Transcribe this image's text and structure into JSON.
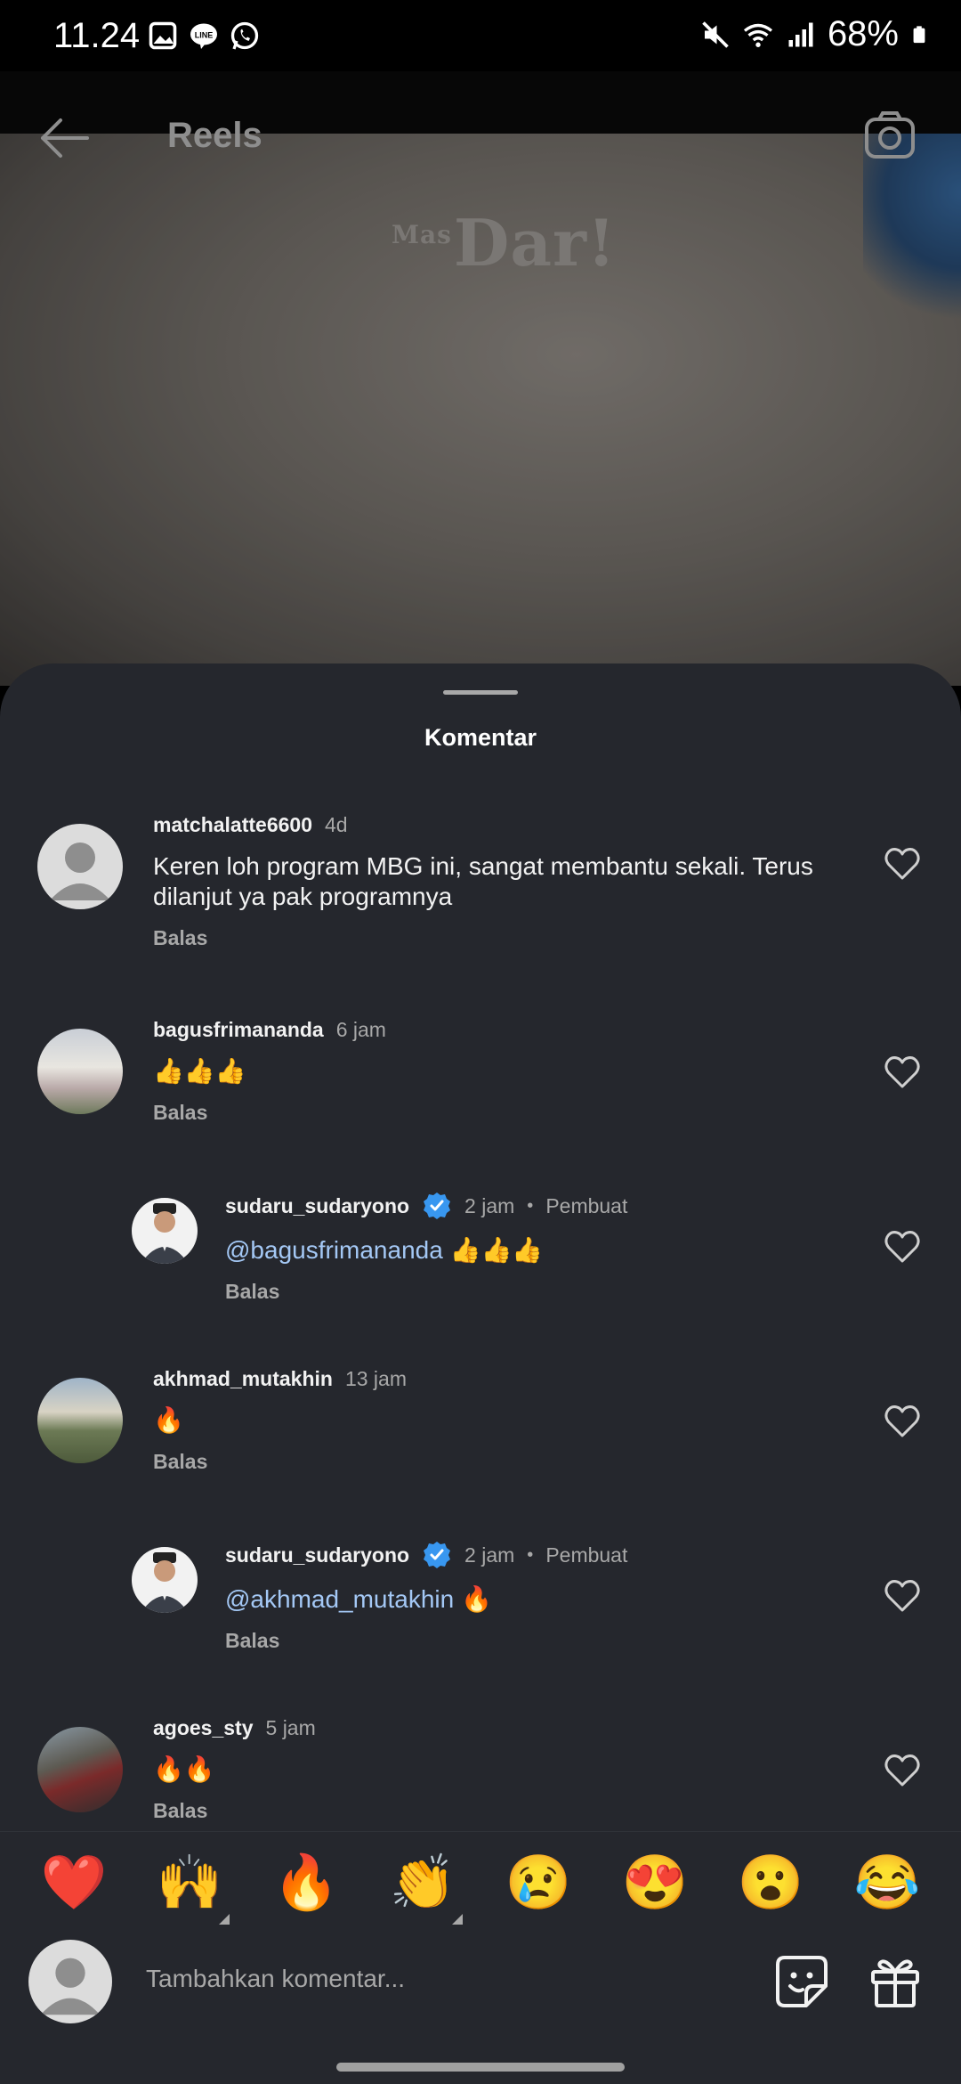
{
  "status_bar": {
    "time": "11.24",
    "battery_percent": "68%",
    "icons": [
      "gallery-icon",
      "line-icon",
      "whatsapp-icon",
      "mute-icon",
      "wifi-icon",
      "signal-icon",
      "battery-icon"
    ]
  },
  "app_bar": {
    "title": "Reels",
    "back_icon": "arrow-left-icon",
    "camera_icon": "camera-icon"
  },
  "video": {
    "watermark_small": "Mas",
    "watermark": "Dar!"
  },
  "sheet": {
    "title": "Komentar"
  },
  "comments": [
    {
      "username": "matchalatte6600",
      "time": "4d",
      "text": "Keren loh program MBG ini, sangat membantu sekali. Terus dilanjut ya pak programnya",
      "reply_label": "Balas",
      "is_reply": false
    },
    {
      "username": "bagusfrimananda",
      "time": "6 jam",
      "text": "👍👍👍",
      "reply_label": "Balas",
      "is_reply": false
    },
    {
      "username": "sudaru_sudaryono",
      "verified": true,
      "time": "2 jam",
      "role": "Pembuat",
      "mention": "@bagusfrimananda",
      "text": " 👍👍👍",
      "reply_label": "Balas",
      "is_reply": true
    },
    {
      "username": "akhmad_mutakhin",
      "time": "13 jam",
      "text": "🔥",
      "reply_label": "Balas",
      "is_reply": false
    },
    {
      "username": "sudaru_sudaryono",
      "verified": true,
      "time": "2 jam",
      "role": "Pembuat",
      "mention": "@akhmad_mutakhin",
      "text": " 🔥",
      "reply_label": "Balas",
      "is_reply": true
    },
    {
      "username": "agoes_sty",
      "time": "5 jam",
      "text": "🔥🔥",
      "reply_label": "Balas",
      "is_reply": false
    }
  ],
  "emoji_bar": {
    "emojis": [
      "❤️",
      "🙌",
      "🔥",
      "👏",
      "😢",
      "😍",
      "😮",
      "😂"
    ]
  },
  "input": {
    "placeholder": "Tambahkan komentar..."
  },
  "colors": {
    "sheet_bg": "#25272d",
    "mention": "#a4c8f5",
    "verified": "#3897f0",
    "muted_text": "#a8a8a8"
  }
}
